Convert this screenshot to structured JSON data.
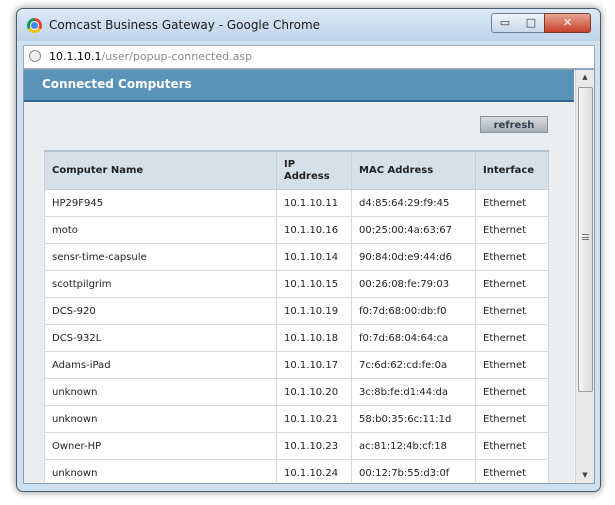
{
  "window": {
    "title": "Comcast Business Gateway - Google Chrome",
    "minimize_glyph": "▭",
    "maximize_glyph": "□",
    "close_glyph": "✕"
  },
  "address": {
    "host": "10.1.10.1",
    "path": "/user/popup-connected.asp"
  },
  "page": {
    "heading": "Connected Computers",
    "refresh_label": "refresh"
  },
  "table": {
    "headers": [
      "Computer Name",
      "IP Address",
      "MAC Address",
      "Interface"
    ],
    "rows": [
      {
        "name": "HP29F945",
        "ip": "10.1.10.11",
        "mac": "d4:85:64:29:f9:45",
        "iface": "Ethernet"
      },
      {
        "name": "moto",
        "ip": "10.1.10.16",
        "mac": "00:25:00:4a:63:67",
        "iface": "Ethernet"
      },
      {
        "name": "sensr-time-capsule",
        "ip": "10.1.10.14",
        "mac": "90:84:0d:e9:44:d6",
        "iface": "Ethernet"
      },
      {
        "name": "scottpilgrim",
        "ip": "10.1.10.15",
        "mac": "00:26:08:fe:79:03",
        "iface": "Ethernet"
      },
      {
        "name": "DCS-920",
        "ip": "10.1.10.19",
        "mac": "f0:7d:68:00:db:f0",
        "iface": "Ethernet"
      },
      {
        "name": "DCS-932L",
        "ip": "10.1.10.18",
        "mac": "f0:7d:68:04:64:ca",
        "iface": "Ethernet"
      },
      {
        "name": "Adams-iPad",
        "ip": "10.1.10.17",
        "mac": "7c:6d:62:cd:fe:0a",
        "iface": "Ethernet"
      },
      {
        "name": "unknown",
        "ip": "10.1.10.20",
        "mac": "3c:8b:fe:d1:44:da",
        "iface": "Ethernet"
      },
      {
        "name": "unknown",
        "ip": "10.1.10.21",
        "mac": "58:b0:35:6c:11:1d",
        "iface": "Ethernet"
      },
      {
        "name": "Owner-HP",
        "ip": "10.1.10.23",
        "mac": "ac:81:12:4b:cf:18",
        "iface": "Ethernet"
      },
      {
        "name": "unknown",
        "ip": "10.1.10.24",
        "mac": "00:12:7b:55:d3:0f",
        "iface": "Ethernet"
      }
    ]
  },
  "scrollbar": {
    "up_glyph": "▲",
    "down_glyph": "▼"
  }
}
